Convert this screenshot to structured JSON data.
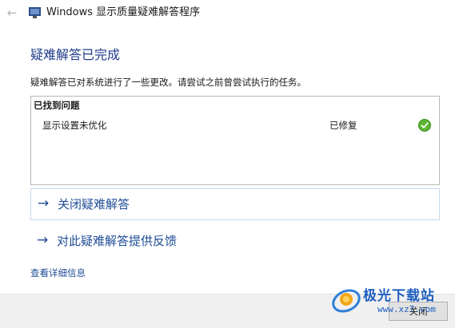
{
  "window": {
    "title": "Windows 显示质量疑难解答程序",
    "back_icon": "back-arrow-icon"
  },
  "heading": "疑难解答已完成",
  "description": "疑难解答已对系统进行了一些更改。请尝试之前曾尝试执行的任务。",
  "results": {
    "header": "已找到问题",
    "items": [
      {
        "name": "显示设置未优化",
        "status": "已修复",
        "status_icon": "check-icon"
      }
    ]
  },
  "actions": [
    {
      "label": "关闭疑难解答",
      "icon": "arrow-right-icon"
    },
    {
      "label": "对此疑难解答提供反馈",
      "icon": "arrow-right-icon"
    }
  ],
  "details_link": "查看详细信息",
  "footer": {
    "close_label": "关闭"
  },
  "watermark": {
    "text": "极光下载站",
    "url": "www.xz7.com"
  },
  "colors": {
    "heading": "#1f3a8a",
    "link": "#1f4d96",
    "check": "#5cb531",
    "footer_bg": "#f0f0f0"
  }
}
